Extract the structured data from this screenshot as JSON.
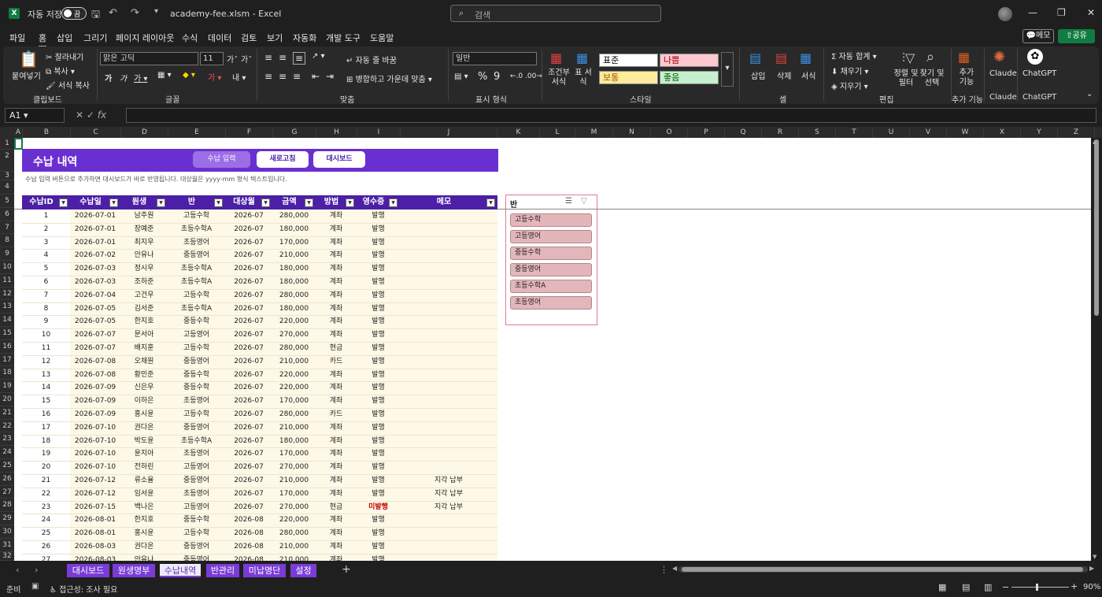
{
  "titlebar": {
    "autosave_label": "자동 저장",
    "autosave_state": "끔",
    "filename": "academy-fee.xlsm - Excel",
    "search_placeholder": "검색"
  },
  "menu": {
    "items": [
      "파일",
      "홈",
      "삽입",
      "그리기",
      "페이지 레이아웃",
      "수식",
      "데이터",
      "검토",
      "보기",
      "자동화",
      "개발 도구",
      "도움말"
    ],
    "memo": "메모",
    "share": "공유"
  },
  "ribbon": {
    "paste": "붙여넣기",
    "cut": "잘라내기",
    "copy": "복사",
    "format_painter": "서식 복사",
    "group_clipboard": "클립보드",
    "font_name": "맑은 고딕",
    "font_size": "11",
    "group_font": "글꼴",
    "wrap_text": "자동 줄 바꿈",
    "merge_center": "병합하고 가운데 맞춤",
    "group_align": "맞춤",
    "number_format": "일반",
    "group_number": "표시 형식",
    "cond_format": "조건부 서식",
    "table_format": "표 서식",
    "style_normal": "표준",
    "style_bad": "나쁨",
    "style_neutral": "보통",
    "style_good": "좋음",
    "group_style": "스타일",
    "insert": "삽입",
    "delete": "삭제",
    "format": "서식",
    "group_cells": "셀",
    "autosum": "자동 합계",
    "fill": "채우기",
    "clear": "지우기",
    "sort_filter": "정렬 및 필터",
    "find_select": "찾기 및 선택",
    "group_edit": "편집",
    "addins": "추가 기능",
    "group_addins": "추가 기능",
    "claude": "Claude",
    "group_claude": "Claude",
    "chatgpt": "ChatGPT",
    "group_chatgpt": "ChatGPT"
  },
  "formula": {
    "namebox": "A1",
    "fx": "fx",
    "value": ""
  },
  "columns": [
    "A",
    "B",
    "C",
    "D",
    "E",
    "F",
    "G",
    "H",
    "I",
    "J",
    "K",
    "L",
    "M",
    "N",
    "O",
    "P",
    "Q",
    "R",
    "S",
    "T",
    "U",
    "V",
    "W",
    "X",
    "Y",
    "Z"
  ],
  "rows": [
    "1",
    "2",
    "3",
    "4",
    "5",
    "6",
    "7",
    "8",
    "9",
    "10",
    "11",
    "12",
    "13",
    "14",
    "15",
    "16",
    "17",
    "18",
    "19",
    "20",
    "21",
    "22",
    "23",
    "24",
    "25",
    "26",
    "27",
    "28",
    "29",
    "30",
    "31",
    "32"
  ],
  "sheet": {
    "title": "수납 내역",
    "btn_input": "수납 입력",
    "btn_refresh": "새로고침",
    "btn_dashboard": "대시보드",
    "hint": "수납 입력 버튼으로 추가하면 대시보드가 바로 반영됩니다. 대상월은 yyyy-mm 형식 텍스트입니다.",
    "headers": [
      "수납ID",
      "수납일",
      "원생",
      "반",
      "대상월",
      "금액",
      "방법",
      "영수증",
      "메모"
    ],
    "rows": [
      [
        "1",
        "2026-07-01",
        "남주원",
        "고등수학",
        "2026-07",
        "280,000",
        "계좌",
        "발행",
        ""
      ],
      [
        "2",
        "2026-07-01",
        "장예준",
        "초등수학A",
        "2026-07",
        "180,000",
        "계좌",
        "발행",
        ""
      ],
      [
        "3",
        "2026-07-01",
        "최지우",
        "초등영어",
        "2026-07",
        "170,000",
        "계좌",
        "발행",
        ""
      ],
      [
        "4",
        "2026-07-02",
        "안유나",
        "중등영어",
        "2026-07",
        "210,000",
        "계좌",
        "발행",
        ""
      ],
      [
        "5",
        "2026-07-03",
        "정시우",
        "초등수학A",
        "2026-07",
        "180,000",
        "계좌",
        "발행",
        ""
      ],
      [
        "6",
        "2026-07-03",
        "조하준",
        "초등수학A",
        "2026-07",
        "180,000",
        "계좌",
        "발행",
        ""
      ],
      [
        "7",
        "2026-07-04",
        "고건우",
        "고등수학",
        "2026-07",
        "280,000",
        "계좌",
        "발행",
        ""
      ],
      [
        "8",
        "2026-07-05",
        "김서준",
        "초등수학A",
        "2026-07",
        "180,000",
        "계좌",
        "발행",
        ""
      ],
      [
        "9",
        "2026-07-05",
        "한지호",
        "중등수학",
        "2026-07",
        "220,000",
        "계좌",
        "발행",
        ""
      ],
      [
        "10",
        "2026-07-07",
        "문서아",
        "고등영어",
        "2026-07",
        "270,000",
        "계좌",
        "발행",
        ""
      ],
      [
        "11",
        "2026-07-07",
        "배지훈",
        "고등수학",
        "2026-07",
        "280,000",
        "현금",
        "발행",
        ""
      ],
      [
        "12",
        "2026-07-08",
        "오채원",
        "중등영어",
        "2026-07",
        "210,000",
        "카드",
        "발행",
        ""
      ],
      [
        "13",
        "2026-07-08",
        "황민준",
        "중등수학",
        "2026-07",
        "220,000",
        "계좌",
        "발행",
        ""
      ],
      [
        "14",
        "2026-07-09",
        "신은우",
        "중등수학",
        "2026-07",
        "220,000",
        "계좌",
        "발행",
        ""
      ],
      [
        "15",
        "2026-07-09",
        "이하은",
        "초등영어",
        "2026-07",
        "170,000",
        "계좌",
        "발행",
        ""
      ],
      [
        "16",
        "2026-07-09",
        "홍시윤",
        "고등수학",
        "2026-07",
        "280,000",
        "카드",
        "발행",
        ""
      ],
      [
        "17",
        "2026-07-10",
        "권다온",
        "중등영어",
        "2026-07",
        "210,000",
        "계좌",
        "발행",
        ""
      ],
      [
        "18",
        "2026-07-10",
        "박도윤",
        "초등수학A",
        "2026-07",
        "180,000",
        "계좌",
        "발행",
        ""
      ],
      [
        "19",
        "2026-07-10",
        "윤지아",
        "초등영어",
        "2026-07",
        "170,000",
        "계좌",
        "발행",
        ""
      ],
      [
        "20",
        "2026-07-10",
        "전하린",
        "고등영어",
        "2026-07",
        "270,000",
        "계좌",
        "발행",
        ""
      ],
      [
        "21",
        "2026-07-12",
        "류소율",
        "중등영어",
        "2026-07",
        "210,000",
        "계좌",
        "발행",
        "지각 납부"
      ],
      [
        "22",
        "2026-07-12",
        "임서윤",
        "초등영어",
        "2026-07",
        "170,000",
        "계좌",
        "발행",
        "지각 납부"
      ],
      [
        "23",
        "2026-07-15",
        "백나은",
        "고등영어",
        "2026-07",
        "270,000",
        "현금",
        "미발행",
        "지각 납부"
      ],
      [
        "24",
        "2026-08-01",
        "한지호",
        "중등수학",
        "2026-08",
        "220,000",
        "계좌",
        "발행",
        ""
      ],
      [
        "25",
        "2026-08-01",
        "홍시윤",
        "고등수학",
        "2026-08",
        "280,000",
        "계좌",
        "발행",
        ""
      ],
      [
        "26",
        "2026-08-03",
        "권다온",
        "중등영어",
        "2026-08",
        "210,000",
        "계좌",
        "발행",
        ""
      ],
      [
        "27",
        "2026-08-03",
        "안유나",
        "중등영어",
        "2026-08",
        "210,000",
        "계좌",
        "발행",
        ""
      ]
    ]
  },
  "slicer": {
    "title": "반",
    "items": [
      "고등수학",
      "고등영어",
      "중등수학",
      "중등영어",
      "초등수학A",
      "초등영어"
    ]
  },
  "tabs": [
    "대시보드",
    "원생명부",
    "수납내역",
    "반관리",
    "미납명단",
    "설정"
  ],
  "status": {
    "ready": "준비",
    "accessibility": "접근성: 조사 필요",
    "zoom": "90%"
  },
  "colors": {
    "banner": "#6a2fd0",
    "header": "#4b1fa6",
    "body_fill": "#fdf9e6",
    "unissued": "#c00000"
  }
}
